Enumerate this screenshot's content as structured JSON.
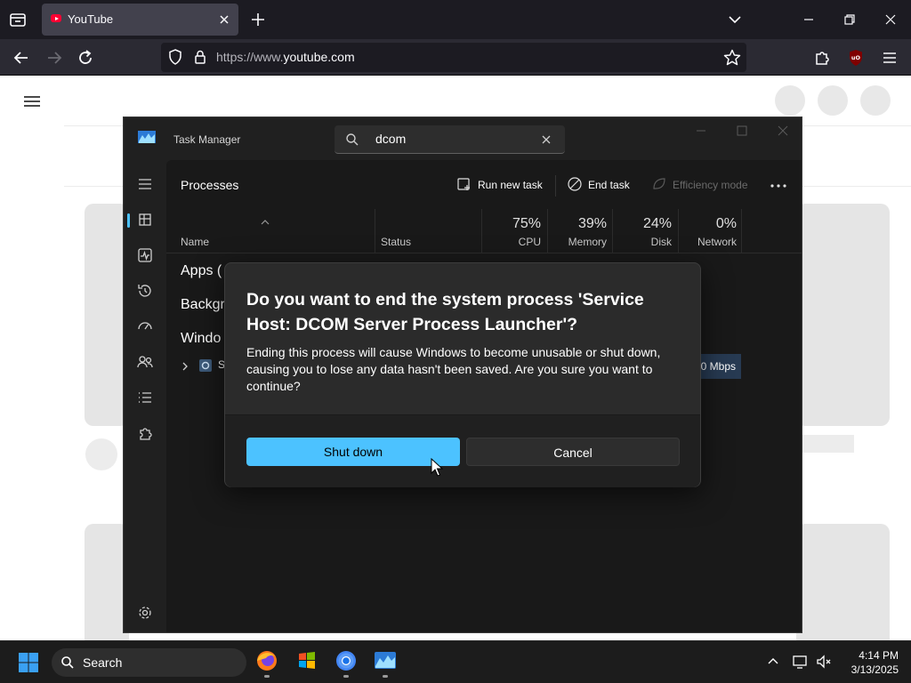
{
  "browser": {
    "tab_title": "YouTube",
    "url_prefix": "https://www.",
    "url_domain": "youtube.com"
  },
  "task_manager": {
    "title": "Task Manager",
    "search_value": "dcom",
    "section_title": "Processes",
    "toolbar": {
      "run_new_task": "Run new task",
      "end_task": "End task",
      "efficiency_mode": "Efficiency mode"
    },
    "columns": {
      "name": "Name",
      "status": "Status",
      "cpu_pct": "75%",
      "cpu": "CPU",
      "memory_pct": "39%",
      "memory": "Memory",
      "disk_pct": "24%",
      "disk": "Disk",
      "network_pct": "0%",
      "network": "Network"
    },
    "groups": {
      "apps": "Apps (",
      "background": "Backgr",
      "windows": "Windo"
    },
    "row_prefix": "S",
    "row_network": "0 Mbps"
  },
  "dialog": {
    "title": "Do you want to end the system process 'Service Host: DCOM Server Process Launcher'?",
    "body": "Ending this process will cause Windows to become unusable or shut down, causing you to lose any data hasn't been saved. Are you sure you want to continue?",
    "confirm_label": "Shut down",
    "cancel_label": "Cancel"
  },
  "taskbar": {
    "search_label": "Search",
    "time": "4:14 PM",
    "date": "3/13/2025"
  },
  "colors": {
    "accent_button": "#4cc2ff",
    "youtube_red": "#ff0033",
    "ublock_red": "#800000"
  }
}
